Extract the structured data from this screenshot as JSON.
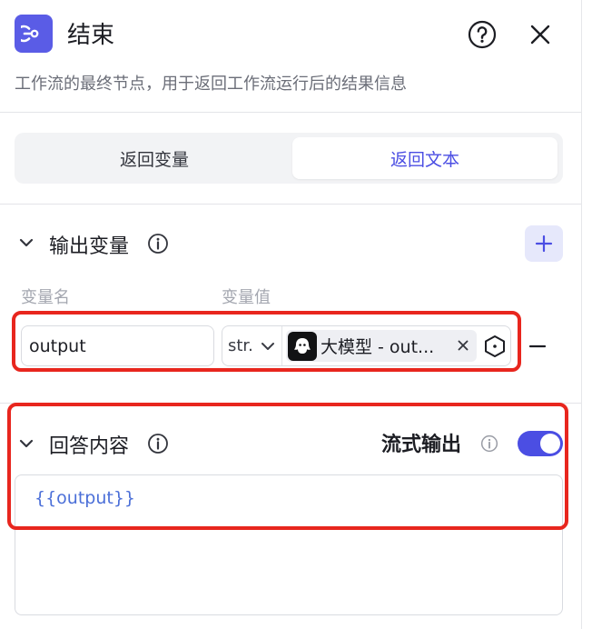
{
  "header": {
    "title": "结束",
    "description": "工作流的最终节点，用于返回工作流运行后的结果信息",
    "icon": "end-node-icon",
    "help_icon": "help-circle-icon",
    "close_icon": "close-icon"
  },
  "tabs": {
    "items": [
      {
        "label": "返回变量",
        "active": false
      },
      {
        "label": "返回文本",
        "active": true
      }
    ]
  },
  "output_section": {
    "title": "输出变量",
    "columns": {
      "name": "变量名",
      "value": "变量值"
    },
    "rows": [
      {
        "name": "output",
        "type": "str.",
        "reference": "大模型 - out..."
      }
    ]
  },
  "answer_section": {
    "title": "回答内容",
    "stream_label": "流式输出",
    "stream_enabled": true,
    "content": "{{output}}"
  },
  "colors": {
    "accent": "#4b4ee3",
    "highlight": "#e8261e",
    "template_text": "#4b6fd8"
  }
}
